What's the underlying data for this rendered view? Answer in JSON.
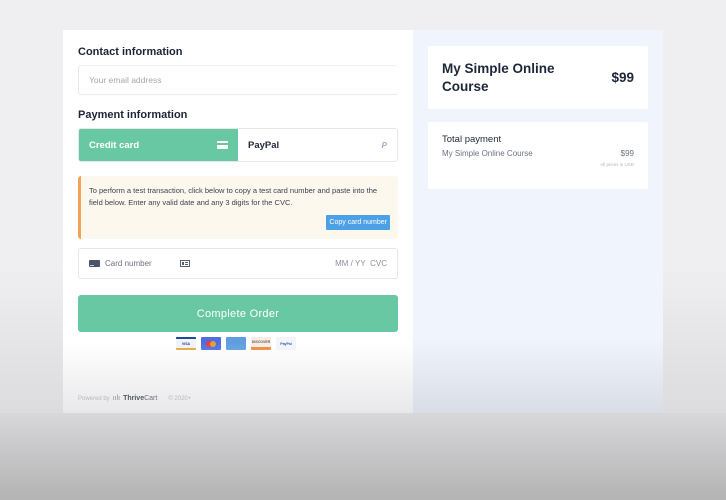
{
  "contact": {
    "title": "Contact information",
    "email_placeholder": "Your email address",
    "email_value": ""
  },
  "payment": {
    "title": "Payment information",
    "tabs": [
      {
        "label": "Credit card",
        "icon": "credit-card-icon",
        "active": true
      },
      {
        "label": "PayPal",
        "icon": "paypal-icon",
        "active": false
      }
    ],
    "paypal_glyph": "P",
    "notice": {
      "text": "To perform a test transaction, click below to copy a test card number and paste into the field below. Enter any valid date and any 3 digits for the CVC.",
      "button_label": "Copy card number"
    },
    "card_field": {
      "number_placeholder": "Card number",
      "expiry_placeholder": "MM / YY",
      "cvc_placeholder": "CVC"
    },
    "submit_label": "Complete Order",
    "card_logos": [
      {
        "name": "visa",
        "label": "VISA"
      },
      {
        "name": "mastercard",
        "label": ""
      },
      {
        "name": "amex",
        "label": "AMERICAN EXPRESS"
      },
      {
        "name": "discover",
        "label": "DISCOVER"
      },
      {
        "name": "paypal",
        "label": "PayPal"
      }
    ]
  },
  "footer": {
    "powered_by": "Powered by",
    "brand_bold": "Thrive",
    "brand_light": "Cart",
    "copyright": "© 2020+"
  },
  "summary": {
    "product_name": "My Simple Online Course",
    "product_price": "$99",
    "total_title": "Total payment",
    "line_item_name": "My Simple Online Course",
    "line_item_price": "$99",
    "currency_note": "All prices in USD"
  },
  "colors": {
    "accent": "#69c8a4",
    "notice_border": "#efa455",
    "notice_bg": "#fdf8ee",
    "copy_button": "#4ca1e6",
    "summary_bg": "#f0f4fd"
  }
}
